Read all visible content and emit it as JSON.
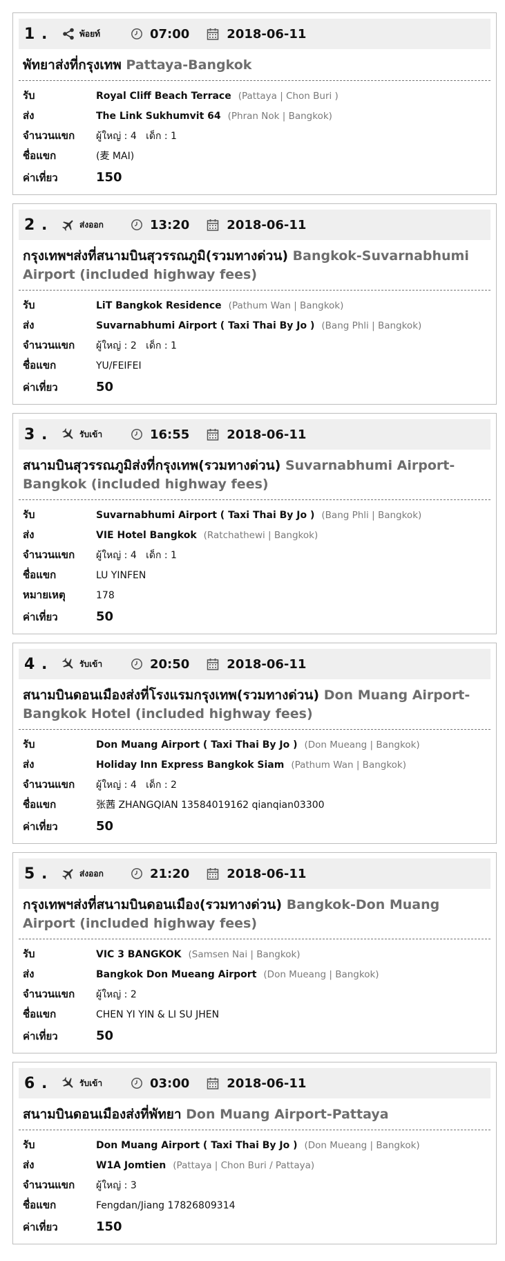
{
  "labels": {
    "pickup": "รับ",
    "dropoff": "ส่ง",
    "passengers": "จำนวนแขก",
    "guest_name": "ชื่อแขก",
    "note": "หมายเหตุ",
    "fare": "ค่าเที่ยว"
  },
  "bookings": [
    {
      "num": "1 .",
      "type_icon": "share-icon",
      "type_label": "พ้อยท์",
      "time": "07:00",
      "date": "2018-06-11",
      "title_th": "พัทยาส่งที่กรุงเทพ",
      "title_en": "Pattaya-Bangkok",
      "pickup": "Royal Cliff Beach Terrace",
      "pickup_area": "(Pattaya | Chon Buri )",
      "dropoff": "The Link Sukhumvit 64",
      "dropoff_area": "(Phran Nok | Bangkok)",
      "passengers": "ผู้ใหญ่ : 4   เด็ก : 1",
      "guest_name": "(麦 MAI)",
      "note": "",
      "fare": "150"
    },
    {
      "num": "2 .",
      "type_icon": "airplane-departure-icon",
      "type_label": "ส่งออก",
      "time": "13:20",
      "date": "2018-06-11",
      "title_th": "กรุงเทพฯส่งที่สนามบินสุวรรณภูมิ(รวมทางด่วน)",
      "title_en": "Bangkok-Suvarnabhumi Airport (included highway fees)",
      "pickup": "LiT Bangkok Residence",
      "pickup_area": "(Pathum Wan | Bangkok)",
      "dropoff": "Suvarnabhumi Airport ( Taxi Thai By Jo )",
      "dropoff_area": "(Bang Phli | Bangkok)",
      "passengers": "ผู้ใหญ่ : 2   เด็ก : 1",
      "guest_name": "YU/FEIFEI",
      "note": "",
      "fare": "50"
    },
    {
      "num": "3 .",
      "type_icon": "airplane-arrival-icon",
      "type_label": "รับเข้า",
      "time": "16:55",
      "date": "2018-06-11",
      "title_th": "สนามบินสุวรรณภูมิส่งที่กรุงเทพ(รวมทางด่วน)",
      "title_en": "Suvarnabhumi Airport-Bangkok (included highway fees)",
      "pickup": "Suvarnabhumi Airport ( Taxi Thai By Jo )",
      "pickup_area": "(Bang Phli | Bangkok)",
      "dropoff": "VIE Hotel Bangkok",
      "dropoff_area": "(Ratchathewi | Bangkok)",
      "passengers": "ผู้ใหญ่ : 4   เด็ก : 1",
      "guest_name": "LU YINFEN",
      "note": "178",
      "fare": "50"
    },
    {
      "num": "4 .",
      "type_icon": "airplane-arrival-icon",
      "type_label": "รับเข้า",
      "time": "20:50",
      "date": "2018-06-11",
      "title_th": "สนามบินดอนเมืองส่งที่โรงแรมกรุงเทพ(รวมทางด่วน)",
      "title_en": "Don Muang Airport-Bangkok Hotel (included highway fees)",
      "pickup": "Don Muang Airport ( Taxi Thai By Jo )",
      "pickup_area": "(Don Mueang | Bangkok)",
      "dropoff": "Holiday Inn Express Bangkok Siam",
      "dropoff_area": "(Pathum Wan | Bangkok)",
      "passengers": "ผู้ใหญ่ : 4   เด็ก : 2",
      "guest_name": "张茜 ZHANGQIAN 13584019162 qianqian03300",
      "note": "",
      "fare": "50"
    },
    {
      "num": "5 .",
      "type_icon": "airplane-departure-icon",
      "type_label": "ส่งออก",
      "time": "21:20",
      "date": "2018-06-11",
      "title_th": "กรุงเทพฯส่งที่สนามบินดอนเมือง(รวมทางด่วน)",
      "title_en": "Bangkok-Don Muang Airport (included highway fees)",
      "pickup": "VIC 3 BANGKOK",
      "pickup_area": "(Samsen Nai | Bangkok)",
      "dropoff": "Bangkok Don Mueang Airport",
      "dropoff_area": "(Don Mueang | Bangkok)",
      "passengers": "ผู้ใหญ่ : 2",
      "guest_name": "CHEN YI YIN & LI SU JHEN",
      "note": "",
      "fare": "50"
    },
    {
      "num": "6 .",
      "type_icon": "airplane-arrival-icon",
      "type_label": "รับเข้า",
      "time": "03:00",
      "date": "2018-06-11",
      "title_th": "สนามบินดอนเมืองส่งที่พัทยา",
      "title_en": "Don Muang Airport-Pattaya",
      "pickup": "Don Muang Airport ( Taxi Thai By Jo )",
      "pickup_area": "(Don Mueang | Bangkok)",
      "dropoff": "W1A Jomtien",
      "dropoff_area": "(Pattaya | Chon Buri / Pattaya)",
      "passengers": "ผู้ใหญ่ : 3",
      "guest_name": "Fengdan/Jiang 17826809314",
      "note": "",
      "fare": "150"
    }
  ]
}
